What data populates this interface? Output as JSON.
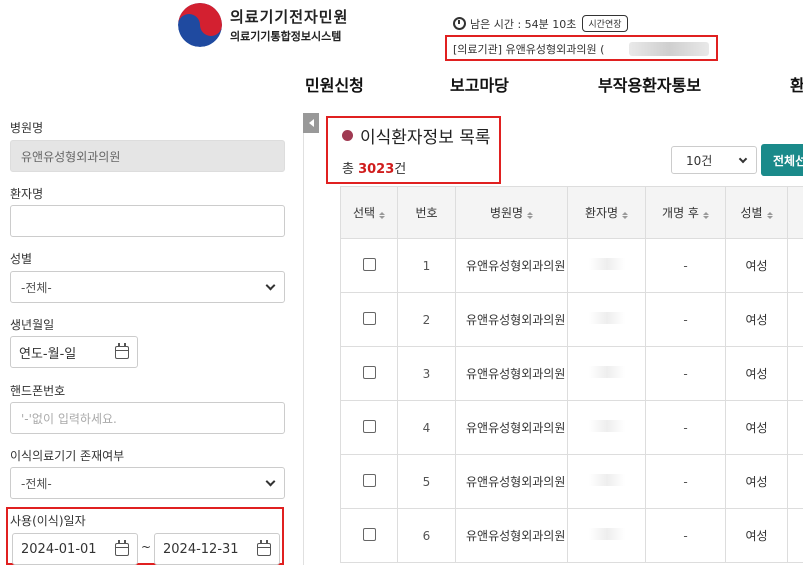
{
  "header": {
    "logo_title": "의료기기전자민원",
    "logo_sub": "의료기기통합정보시스템",
    "timer_label": "남은 시간 : 54분 10초",
    "extend_button": "시간연장",
    "org_label": "[의료기관] 유앤유성형외과의원 ("
  },
  "gnb": {
    "items": [
      "민원신청",
      "보고마당",
      "부작용환자통보",
      "환"
    ]
  },
  "sidebar": {
    "hospital_name_label": "병원명",
    "hospital_name_value": "유앤유성형외과의원",
    "patient_name_label": "환자명",
    "patient_name_value": "",
    "gender_label": "성별",
    "gender_value": "-전체-",
    "birth_label": "생년월일",
    "birth_placeholder": "연도-월-일",
    "phone_label": "핸드폰번호",
    "phone_placeholder": "'-'없이 입력하세요.",
    "device_exists_label": "이식의료기기 존재여부",
    "device_exists_value": "-전체-",
    "use_date_label": "사용(이식)일자",
    "use_date_from": "2024-01-01",
    "use_date_to": "2024-12-31",
    "tilde": "~"
  },
  "main": {
    "list_title": "이식환자정보 목록",
    "total_prefix": "총 ",
    "total_count": "3023",
    "total_suffix": "건",
    "page_size": "10건",
    "all_button": "전체선"
  },
  "table": {
    "headers": [
      "선택",
      "번호",
      "병원명",
      "환자명",
      "개명 후",
      "성별"
    ],
    "rows": [
      {
        "no": "1",
        "hospital": "유앤유성형외과의원",
        "patient": "",
        "renamed": "-",
        "gender": "여성"
      },
      {
        "no": "2",
        "hospital": "유앤유성형외과의원",
        "patient": "",
        "renamed": "-",
        "gender": "여성"
      },
      {
        "no": "3",
        "hospital": "유앤유성형외과의원",
        "patient": "",
        "renamed": "-",
        "gender": "여성"
      },
      {
        "no": "4",
        "hospital": "유앤유성형외과의원",
        "patient": "",
        "renamed": "-",
        "gender": "여성"
      },
      {
        "no": "5",
        "hospital": "유앤유성형외과의원",
        "patient": "",
        "renamed": "-",
        "gender": "여성"
      },
      {
        "no": "6",
        "hospital": "유앤유성형외과의원",
        "patient": "",
        "renamed": "-",
        "gender": "여성"
      }
    ]
  },
  "colors": {
    "highlight_red": "#e02020",
    "count_red": "#d01c1c",
    "accent_teal": "#1a8a8a",
    "title_dot": "#a03a52"
  }
}
